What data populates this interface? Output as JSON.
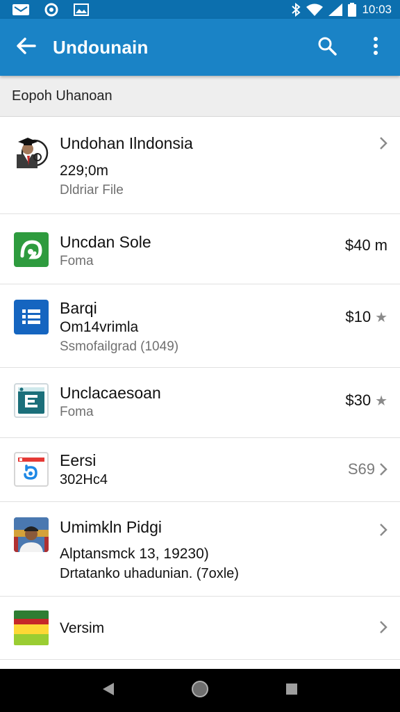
{
  "status_bar": {
    "time": "10:03",
    "left_icons": [
      "mail-icon",
      "circle-notification-icon",
      "image-icon"
    ],
    "right_icons": [
      "bluetooth-icon",
      "wifi-icon",
      "signal-icon",
      "battery-icon"
    ]
  },
  "app_bar": {
    "title": "Undounain",
    "back_icon": "arrow-back-icon",
    "search_icon": "search-icon",
    "more_icon": "more-vert-icon",
    "color": "#1a83c6"
  },
  "subheader": {
    "label": "Eopoh Uhanoan"
  },
  "items": [
    {
      "title": "Undohan Ilndonsia",
      "line2": "229;0m",
      "subtitle": "Dldriar File",
      "right_text": "",
      "right_icon": "chevron-right-icon",
      "icon": "graduate-avatar-icon"
    },
    {
      "title": "Uncdan Sole",
      "line2": "",
      "subtitle": "Foma",
      "right_text": "$40 m",
      "right_icon": "",
      "icon": "green-app-icon"
    },
    {
      "title": "Barqi",
      "line2": "Om14vrimla",
      "subtitle": "Ssmofailgrad (1049)",
      "right_text": "$10",
      "right_icon": "star-icon",
      "icon": "list-app-icon"
    },
    {
      "title": "Unclacaesoan",
      "line2": "",
      "subtitle": "Foma",
      "right_text": "$30",
      "right_icon": "star-icon",
      "icon": "document-app-icon"
    },
    {
      "title": "Eersi",
      "line2": "",
      "subtitle": "302Hc4",
      "right_text": "S69",
      "right_icon": "chevron-right-icon",
      "icon": "red-blue-app-icon"
    },
    {
      "title": "Umimkln Pidgi",
      "line2": "Alptansmck 13, 19230)",
      "subtitle": "Drtatanko uhadunian. (7oxle)",
      "right_text": "",
      "right_icon": "chevron-right-icon",
      "icon": "person-photo-icon"
    },
    {
      "title": "Versim",
      "line2": "",
      "subtitle": "",
      "right_text": "",
      "right_icon": "chevron-right-icon",
      "icon": "flag-icon"
    }
  ],
  "nav_bar": {
    "buttons": [
      "back-triangle-icon",
      "home-circle-icon",
      "recents-square-icon"
    ]
  }
}
